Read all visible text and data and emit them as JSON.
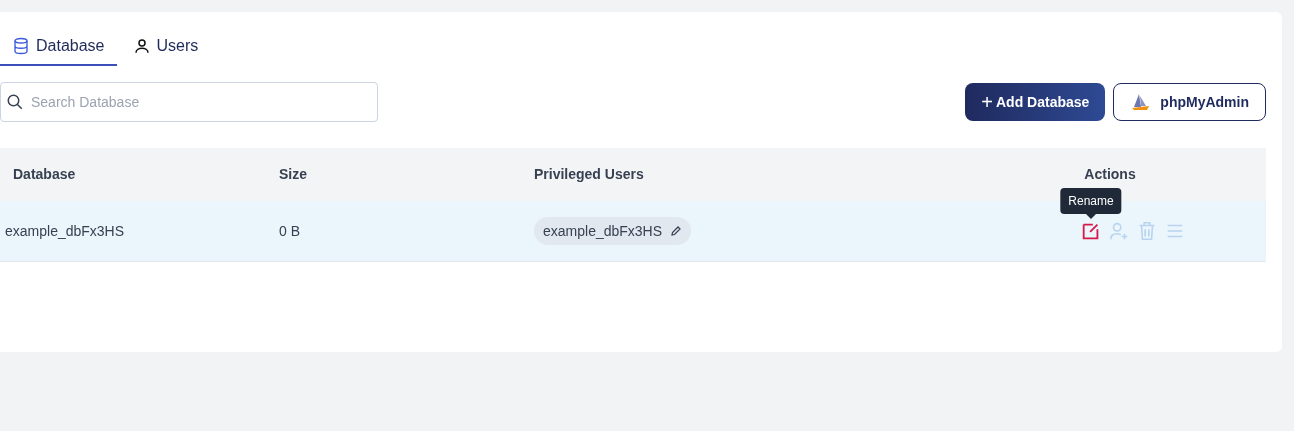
{
  "tabs": [
    {
      "label": "Database",
      "kind": "database",
      "selected": true
    },
    {
      "label": "Users",
      "kind": "user",
      "selected": false
    }
  ],
  "search": {
    "placeholder": "Search Database"
  },
  "buttons": [
    {
      "label": "+",
      "text": "Add Database",
      "kind": "primary"
    },
    {
      "text": "phpMyAdmin",
      "kind": "outline"
    }
  ],
  "table": {
    "columns": [
      "Database",
      "Size",
      "Privileged Users",
      "Actions"
    ],
    "rows": [
      {
        "database": "example_dbFx3HS",
        "size": "0 B",
        "users": [
          "example_dbFx3HS"
        ],
        "highlighted": true,
        "actions": [
          {
            "kind": "edit",
            "active": true,
            "tooltip": "Rename"
          },
          {
            "kind": "add-user",
            "active": false
          },
          {
            "kind": "delete",
            "active": false
          },
          {
            "kind": "menu",
            "active": false
          }
        ]
      }
    ]
  }
}
